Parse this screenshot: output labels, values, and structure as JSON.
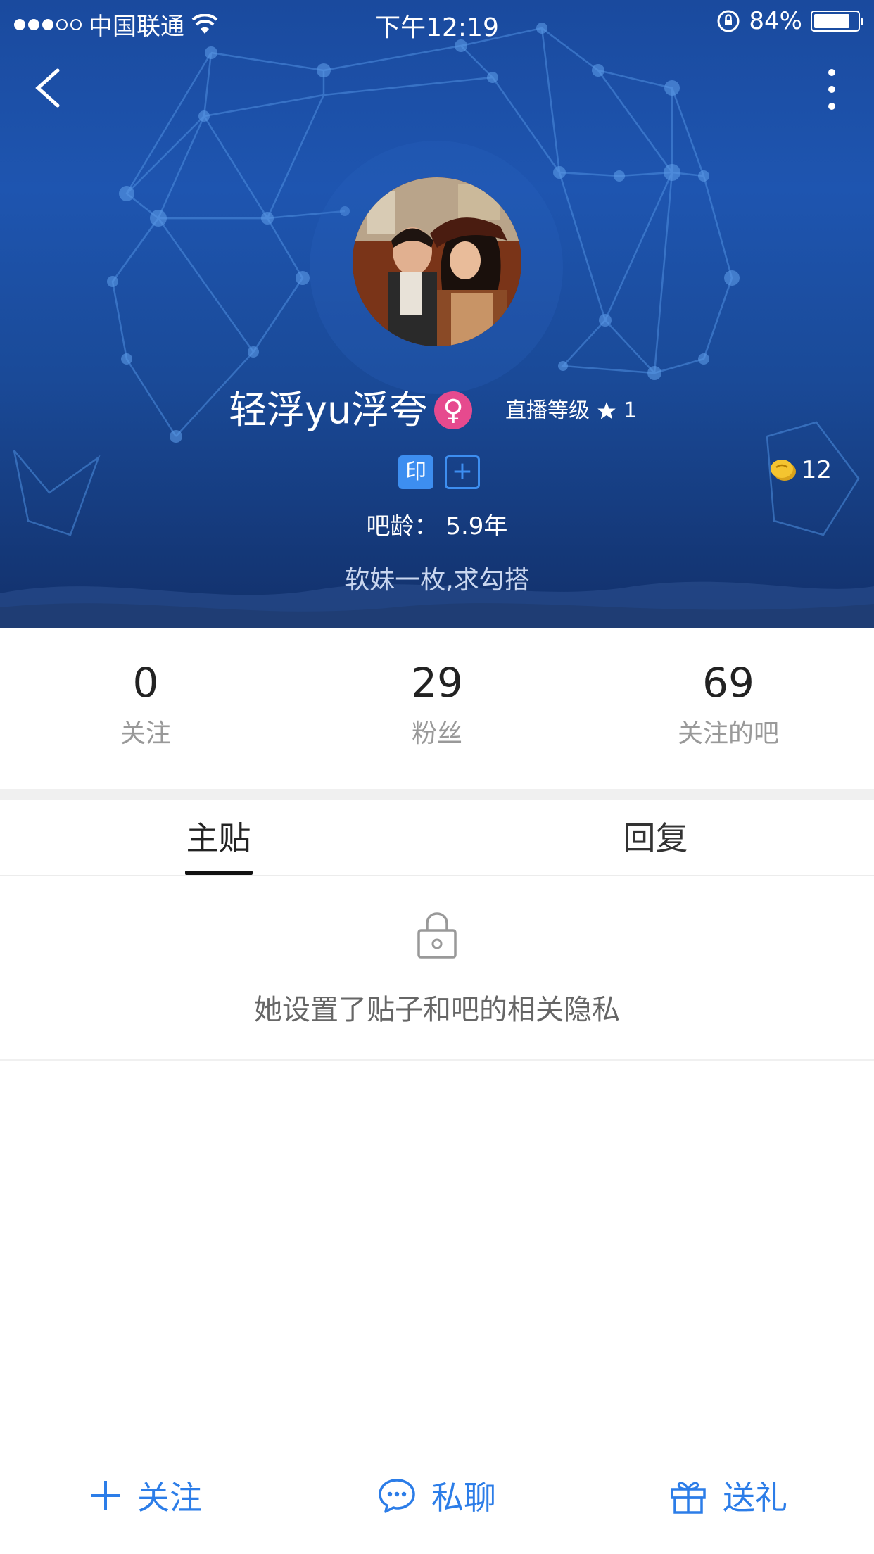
{
  "status_bar": {
    "carrier": "中国联通",
    "time": "下午12:19",
    "battery": "84%",
    "battery_level": 0.84
  },
  "profile": {
    "name": "轻浮yu浮夸",
    "gender_symbol": "♀",
    "live_level_label": "直播等级",
    "live_level_value": "1",
    "badge_yin": "印",
    "badge_plus": "+",
    "coins": "12",
    "bar_age": "吧龄： 5.9年",
    "signature": "软妹一枚,求勾搭"
  },
  "stats": [
    {
      "value": "0",
      "label": "关注"
    },
    {
      "value": "29",
      "label": "粉丝"
    },
    {
      "value": "69",
      "label": "关注的吧"
    }
  ],
  "tabs": [
    {
      "label": "主贴",
      "active": true
    },
    {
      "label": "回复",
      "active": false
    }
  ],
  "privacy_notice": "她设置了贴子和吧的相关隐私",
  "actions": {
    "follow": "关注",
    "chat": "私聊",
    "gift": "送礼"
  },
  "colors": {
    "accent": "#2c7de8",
    "hero_top": "#1e55b0",
    "hero_bottom": "#12306a",
    "gender": "#e64a8e"
  }
}
